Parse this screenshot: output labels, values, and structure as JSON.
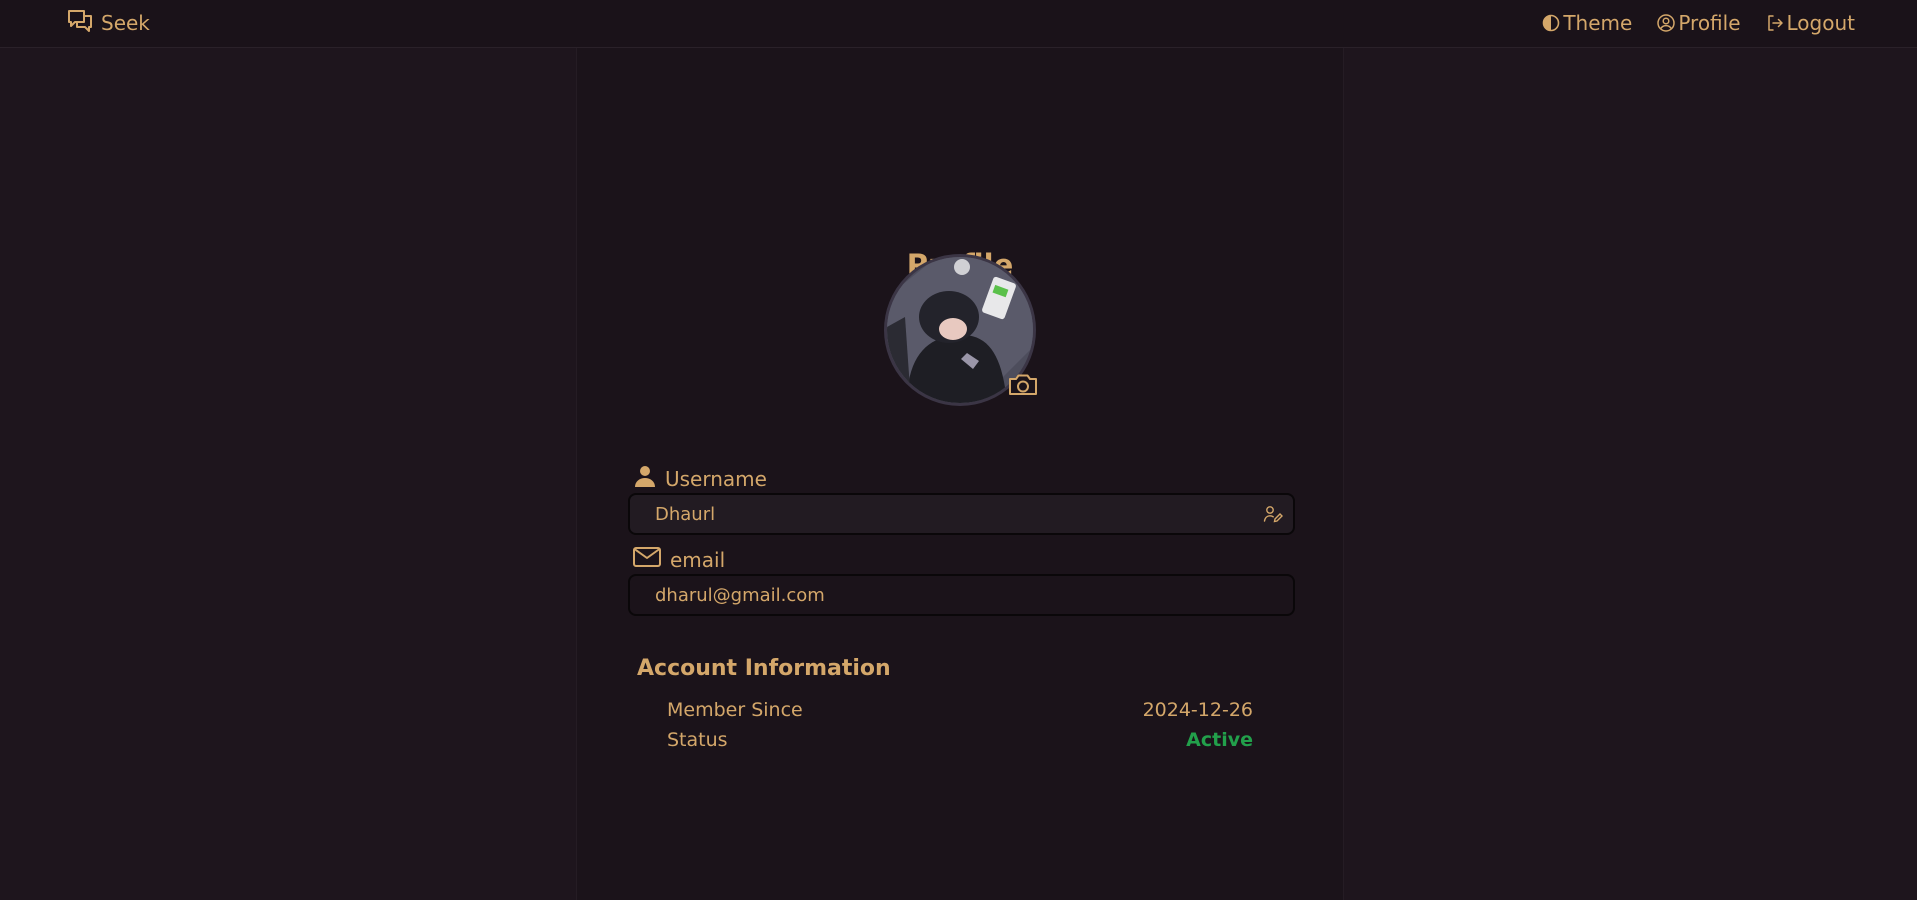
{
  "navbar": {
    "brand": {
      "label": "Seek",
      "icon": "chat-bubbles-icon"
    },
    "links": [
      {
        "label": "Theme",
        "icon": "half-circle-icon"
      },
      {
        "label": "Profile",
        "icon": "user-circle-icon"
      },
      {
        "label": "Logout",
        "icon": "logout-icon"
      }
    ]
  },
  "profile": {
    "title": "Profile",
    "avatar_icon": "camera-icon",
    "fields": {
      "username": {
        "label": "Username",
        "value": "Dhaurl",
        "icon": "person-icon",
        "action_icon": "user-edit-icon"
      },
      "email": {
        "label": "email",
        "value": "dharul@gmail.com",
        "icon": "envelope-icon"
      }
    }
  },
  "account": {
    "title": "Account Information",
    "member_since_label": "Member Since",
    "member_since_value": "2024-12-26",
    "status_label": "Status",
    "status_value": "Active"
  },
  "colors": {
    "accent": "#d4a76a",
    "background": "#1e151d",
    "status_active": "#22a04b"
  }
}
